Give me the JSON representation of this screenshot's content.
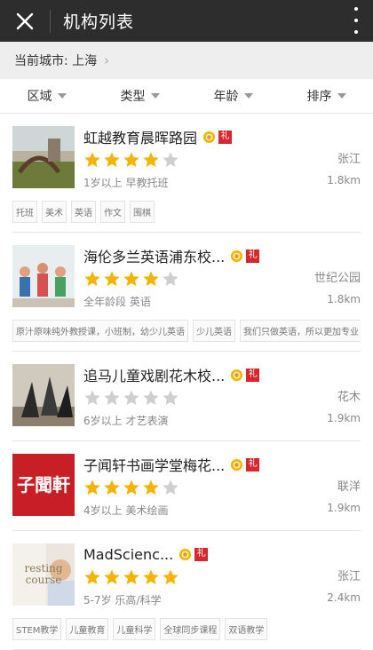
{
  "appbar": {
    "title": "机构列表"
  },
  "city": {
    "label": "当前城市: 上海"
  },
  "filters": [
    "区域",
    "类型",
    "年龄",
    "排序"
  ],
  "colors": {
    "star_on": "#f5b400",
    "star_off": "#cfcfcf",
    "gift": "#d9272e",
    "appbar": "#2d2d2d"
  },
  "items": [
    {
      "name": "虹越教育晨晖路园",
      "rating": 4,
      "meta": "1岁以上 早教托班",
      "location": "张江",
      "distance": "1.8km",
      "tags": [
        "托班",
        "美术",
        "英语",
        "作文",
        "围棋"
      ],
      "thumb_text": ""
    },
    {
      "name": "海伦多兰英语浦东校...",
      "rating": 4,
      "meta": "全年龄段 英语",
      "location": "世纪公园",
      "distance": "1.8km",
      "tags": [
        "原汁原味纯外教授课，小班制，幼少儿英语",
        "少儿英语",
        "我们只做英语，所以更加专业"
      ],
      "thumb_text": ""
    },
    {
      "name": "追马儿童戏剧花木校...",
      "rating": 0,
      "meta": "6岁以上 才艺表演",
      "location": "花木",
      "distance": "1.9km",
      "tags": [],
      "thumb_text": ""
    },
    {
      "name": "子闻轩书画学堂梅花...",
      "rating": 4,
      "meta": "4岁以上 美术绘画",
      "location": "联洋",
      "distance": "1.9km",
      "tags": [],
      "thumb_text": "子聞軒"
    },
    {
      "name": "MadScienc...",
      "rating": 5,
      "meta": "5-7岁 乐高/科学",
      "location": "张江",
      "distance": "2.4km",
      "tags": [
        "STEM教学",
        "儿童教育",
        "儿童科学",
        "全球同步课程",
        "双语教学"
      ],
      "thumb_text": "resting course"
    }
  ],
  "icons": {
    "close": "close-icon",
    "more": "more-vertical-icon",
    "chevron": "chevron-right-icon",
    "medal": "medal-icon",
    "gift": "gift-badge-icon"
  },
  "gift_label": "礼"
}
